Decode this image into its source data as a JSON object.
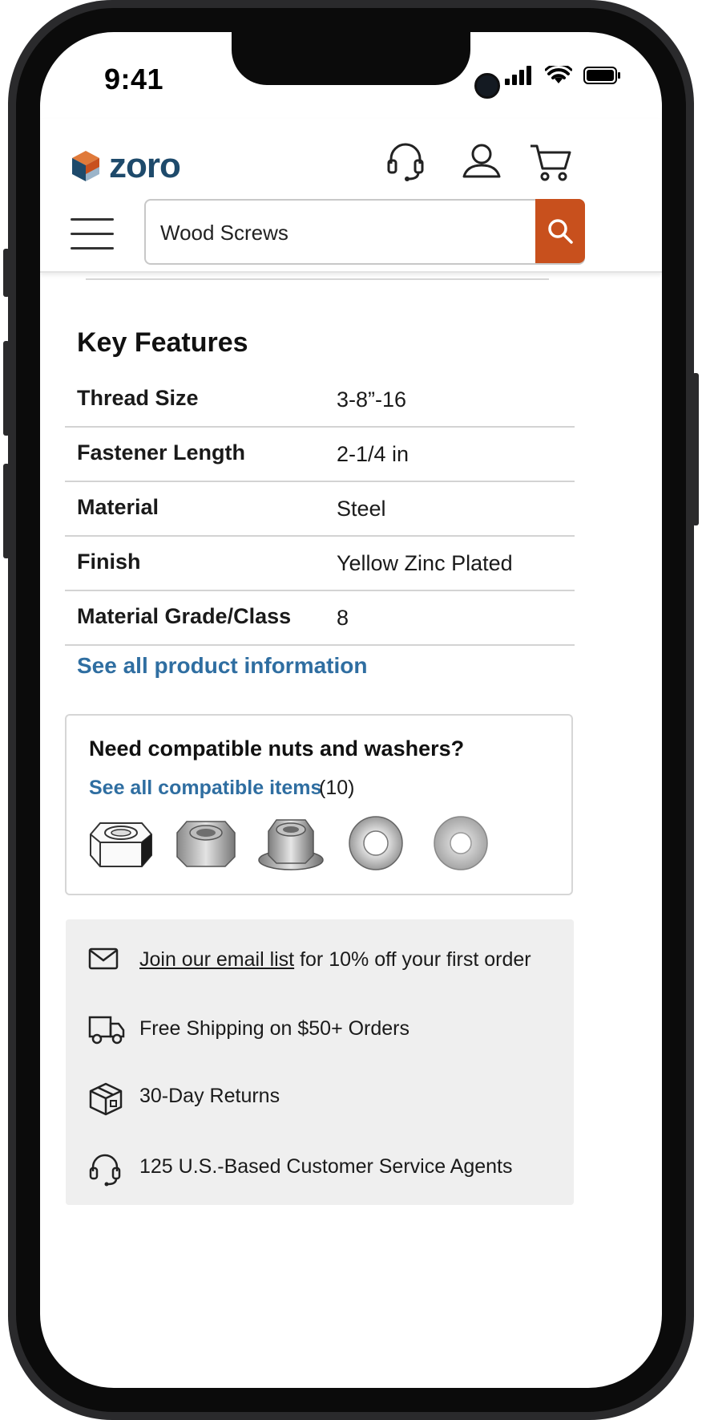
{
  "status_bar": {
    "time": "9:41"
  },
  "header": {
    "logo_text": "zoro",
    "icons": [
      "headset-icon",
      "user-icon",
      "cart-icon"
    ],
    "search": {
      "value": "Wood Screws",
      "placeholder": ""
    },
    "colors": {
      "brand": "#1e4a6b",
      "accent": "#c8501d",
      "link": "#2f6ea1"
    }
  },
  "key_features": {
    "title": "Key Features",
    "rows": [
      {
        "label": "Thread Size",
        "value": "3-8”-16"
      },
      {
        "label": "Fastener Length",
        "value": "2-1/4 in"
      },
      {
        "label": "Material",
        "value": "Steel"
      },
      {
        "label": "Finish",
        "value": "Yellow Zinc Plated"
      },
      {
        "label": "Material Grade/Class",
        "value": "8"
      }
    ],
    "see_all_link": "See all product information"
  },
  "compatible": {
    "title": "Need compatible nuts and washers?",
    "link": "See all compatible items",
    "count": "(10)",
    "items": [
      "hex-nut-plain",
      "hex-nut-zinc",
      "flange-nut",
      "flat-washer-polished",
      "flat-washer-galvanized"
    ]
  },
  "perks": {
    "email_link": "Join our email list",
    "email_rest": " for 10% off your first order",
    "shipping": "Free Shipping on $50+ Orders",
    "returns": "30-Day Returns",
    "service": "125 U.S.-Based Customer Service Agents"
  }
}
